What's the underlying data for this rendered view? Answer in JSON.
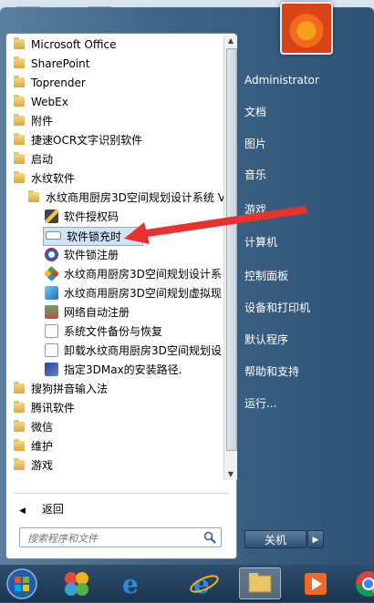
{
  "desktop": {
    "icons": [
      "word-doc-icon",
      "word-doc-icon",
      "folder-icon",
      "qq-penguin-icon"
    ]
  },
  "start_menu": {
    "programs": [
      {
        "label": "Microsoft Office",
        "kind": "folder"
      },
      {
        "label": "SharePoint",
        "kind": "folder"
      },
      {
        "label": "Toprender",
        "kind": "folder"
      },
      {
        "label": "WebEx",
        "kind": "folder"
      },
      {
        "label": "附件",
        "kind": "folder"
      },
      {
        "label": "捷速OCR文字识别软件",
        "kind": "folder"
      },
      {
        "label": "启动",
        "kind": "folder"
      },
      {
        "label": "水纹软件",
        "kind": "folder"
      },
      {
        "label": "水纹商用厨房3D空间规划设计系统 V",
        "kind": "subfolder"
      },
      {
        "label": "软件授权码",
        "kind": "app"
      },
      {
        "label": "软件锁充时",
        "kind": "app"
      },
      {
        "label": "软件锁注册",
        "kind": "app"
      },
      {
        "label": "水纹商用厨房3D空间规划设计系",
        "kind": "app"
      },
      {
        "label": "水纹商用厨房3D空间规划虚拟现",
        "kind": "app"
      },
      {
        "label": "网络自动注册",
        "kind": "app"
      },
      {
        "label": "系统文件备份与恢复",
        "kind": "app"
      },
      {
        "label": "卸载水纹商用厨房3D空间规划设",
        "kind": "app"
      },
      {
        "label": "指定3DMax的安装路径.",
        "kind": "app"
      },
      {
        "label": "搜狗拼音输入法",
        "kind": "folder"
      },
      {
        "label": "腾讯软件",
        "kind": "folder"
      },
      {
        "label": "微信",
        "kind": "folder"
      },
      {
        "label": "维护",
        "kind": "folder"
      },
      {
        "label": "游戏",
        "kind": "folder"
      }
    ],
    "back_label": "返回",
    "search_placeholder": "搜索程序和文件",
    "right_items": [
      "Administrator",
      "文档",
      "图片",
      "音乐",
      "游戏",
      "计算机",
      "控制面板",
      "设备和打印机",
      "默认程序",
      "帮助和支持",
      "运行..."
    ],
    "shutdown_label": "关机"
  },
  "colors": {
    "annotation_arrow": "#e8322e",
    "selection": "#cfe3f7"
  }
}
